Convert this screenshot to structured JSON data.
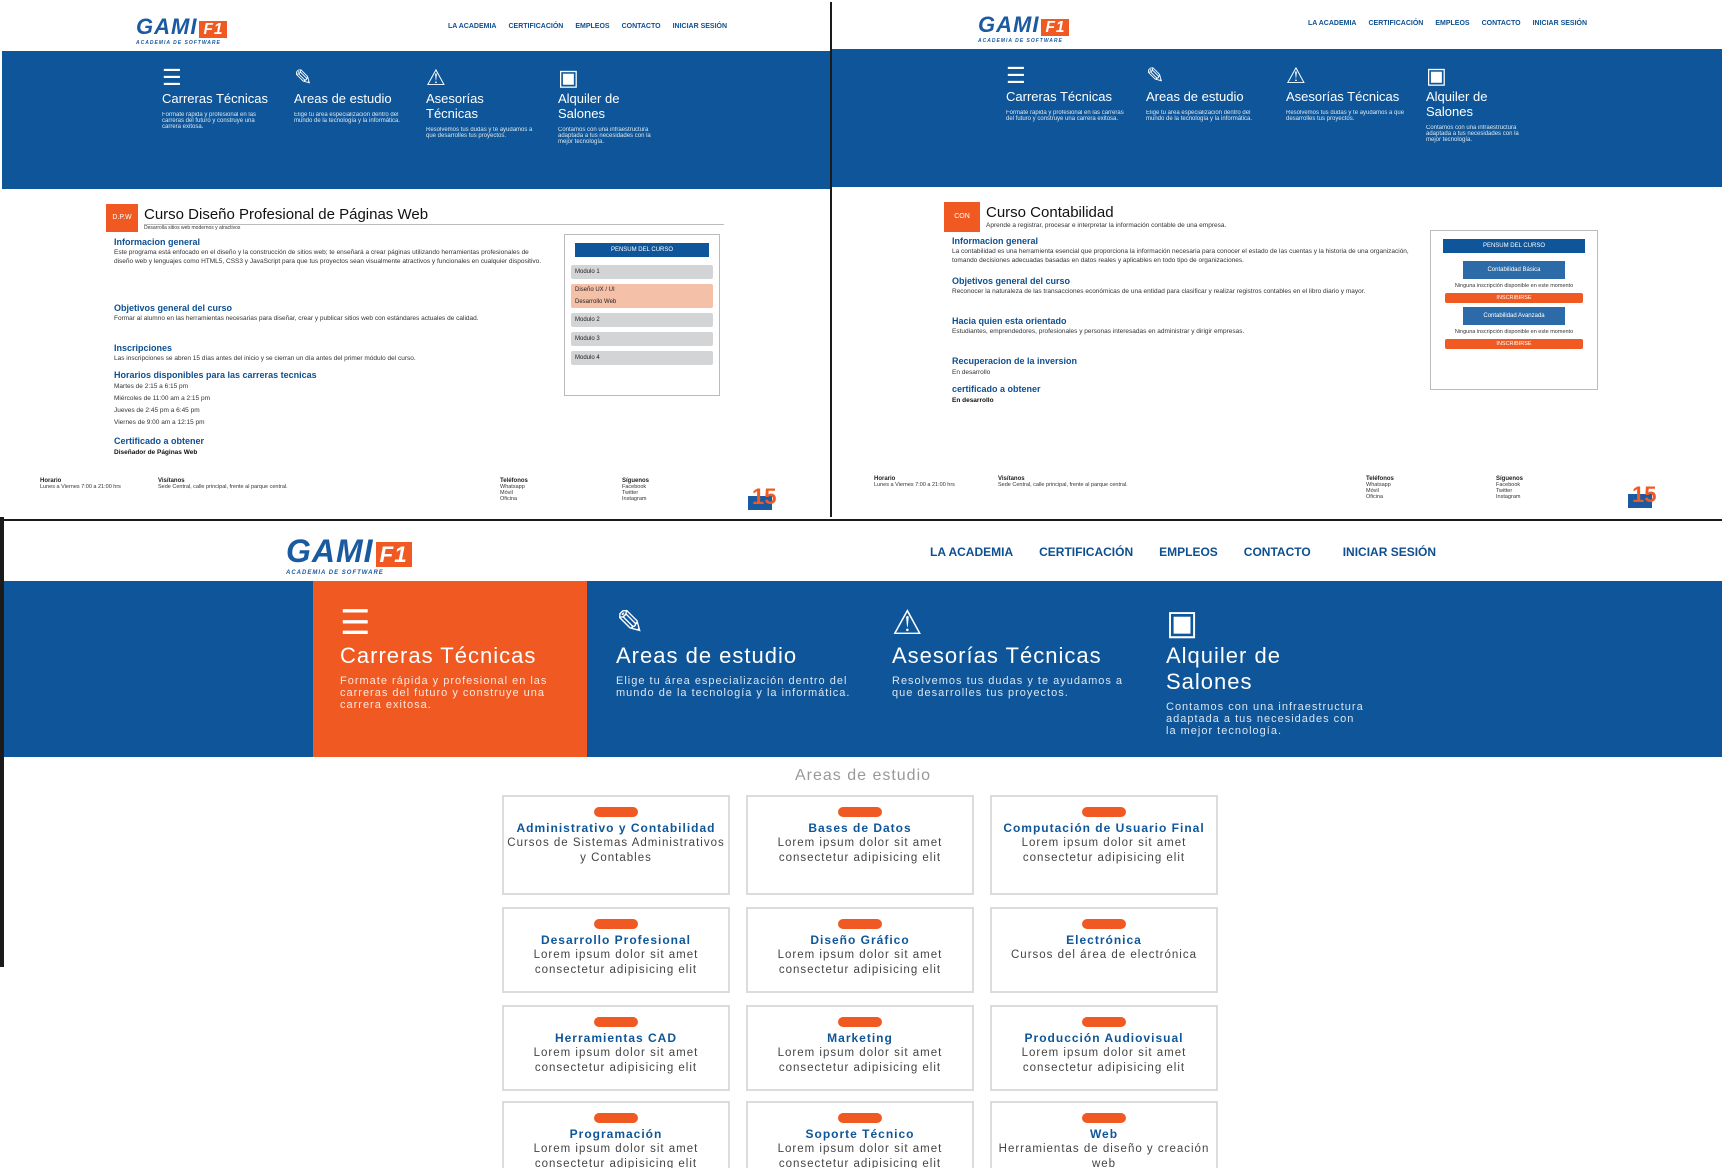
{
  "logo": {
    "text": "GAMI",
    "badge": "F1",
    "subtitle": "ACADEMIA DE SOFTWARE"
  },
  "nav": [
    "LA ACADEMIA",
    "CERTIFICACIÓN",
    "EMPLEOS",
    "CONTACTO",
    "INICIAR SESIÓN"
  ],
  "hero_tiles": [
    {
      "icon": "layers-icon",
      "title": "Carreras Técnicas",
      "desc": "Formate rápida y profesional en las carreras del futuro y construye una carrera exitosa."
    },
    {
      "icon": "edit-icon",
      "title": "Areas de estudio",
      "desc": "Elige tu área especialización dentro del mundo de la tecnología y la informática."
    },
    {
      "icon": "exclamation-icon",
      "title": "Asesorías Técnicas",
      "desc": "Resolvemos tus dudas y te ayudamos a que desarrolles tus proyectos."
    },
    {
      "icon": "board-icon",
      "title": "Alquiler de Salones",
      "desc": "Contamos con una infraestructura adaptada a tus necesidades con la mejor tecnología."
    }
  ],
  "course1": {
    "code": "D.P.W",
    "title": "Curso Diseño Profesional de Páginas Web",
    "subtitle": "Desarrolla sitios web modernos y atractivos",
    "sections": [
      {
        "heading": "Informacion general",
        "text": "Este programa está enfocado en el diseño y la construcción de sitios web; te enseñará a crear páginas utilizando herramientas profesionales de diseño web y lenguajes como HTML5, CSS3 y JavaScript para que tus proyectos sean visualmente atractivos y funcionales en cualquier dispositivo."
      },
      {
        "heading": "Objetivos general del curso",
        "text": "Formar al alumno en las herramientas necesarias para diseñar, crear y publicar sitios web con estándares actuales de calidad."
      },
      {
        "heading": "Inscripciones",
        "text": "Las inscripciones se abren 15 días antes del inicio y se cierran un día antes del primer módulo del curso."
      },
      {
        "heading": "Horarios disponibles para las carreras tecnicas",
        "lines": [
          "Martes de 2:15 a 6:15 pm",
          "Miércoles de 11:00 am a 2:15 pm",
          "Jueves de 2:45 pm a 6:45 pm",
          "Viernes de 9:00 am a 12:15 pm"
        ]
      },
      {
        "heading": "Certificado a obtener",
        "value": "Diseñador de Páginas Web"
      }
    ],
    "sidebar": {
      "header": "PENSUM DEL CURSO",
      "modules": [
        "Modulo 1",
        "Diseño UX / UI",
        "Desarrollo Web",
        "Modulo 2",
        "Modulo 3",
        "Modulo 4"
      ]
    }
  },
  "course2": {
    "code": "CON",
    "title": "Curso Contabilidad",
    "subtitle": "Aprende a registrar, procesar e interpretar la información contable de una empresa.",
    "sections": [
      {
        "heading": "Informacion general",
        "text": "La contabilidad es una herramienta esencial que proporciona la información necesaria para conocer el estado de las cuentas y la historia de una organización, tomando decisiones adecuadas basadas en datos reales y aplicables en todo tipo de organizaciones."
      },
      {
        "heading": "Objetivos general del curso",
        "text": "Reconocer la naturaleza de las transacciones económicas de una entidad para clasificar y realizar registros contables en el libro diario y mayor."
      },
      {
        "heading": "Hacia quien esta orientado",
        "text": "Estudiantes, emprendedores, profesionales y personas interesadas en administrar y dirigir empresas."
      },
      {
        "heading": "Recuperacion de la inversion",
        "value": "En desarrollo"
      },
      {
        "heading": "certificado a obtener",
        "value": "En desarrollo"
      }
    ],
    "sidebar": {
      "header": "PENSUM DEL CURSO",
      "blocks": [
        {
          "title": "Contabilidad Básica",
          "note": "Ninguna inscripción disponible en este momento",
          "button": "INSCRIBIRSE"
        },
        {
          "title": "Contabilidad Avanzada",
          "note": "Ninguna inscripción disponible en este momento",
          "button": "INSCRIBIRSE"
        }
      ]
    }
  },
  "footer": {
    "col1_title": "Horario",
    "col1_text": "Lunes a Viernes 7:00 a 21:00 hrs",
    "col2_title": "Visítanos",
    "col2_text": "Sede Central, calle principal, frente al parque central.",
    "col3_title": "Teléfonos",
    "col3_lines": [
      "Whatsapp",
      "Móvil",
      "Oficina"
    ],
    "col4_title": "Síguenos",
    "col4_lines": [
      "Facebook",
      "Twitter",
      "Instagram"
    ]
  },
  "landing": {
    "areas_title": "Areas de estudio",
    "cards": [
      {
        "title": "Administrativo y Contabilidad",
        "desc": "Cursos de Sistemas Administrativos y Contables"
      },
      {
        "title": "Bases de Datos",
        "desc": "Lorem ipsum dolor sit amet consectetur adipisicing elit"
      },
      {
        "title": "Computación de Usuario Final",
        "desc": "Lorem ipsum dolor sit amet consectetur adipisicing elit"
      },
      {
        "title": "Desarrollo Profesional",
        "desc": "Lorem ipsum dolor sit amet consectetur adipisicing elit"
      },
      {
        "title": "Diseño Gráfico",
        "desc": "Lorem ipsum dolor sit amet consectetur adipisicing elit"
      },
      {
        "title": "Electrónica",
        "desc": "Cursos del área de electrónica"
      },
      {
        "title": "Herramientas CAD",
        "desc": "Lorem ipsum dolor sit amet consectetur adipisicing elit"
      },
      {
        "title": "Marketing",
        "desc": "Lorem ipsum dolor sit amet consectetur adipisicing elit"
      },
      {
        "title": "Producción Audiovisual",
        "desc": "Lorem ipsum dolor sit amet consectetur adipisicing elit"
      },
      {
        "title": "Programación",
        "desc": "Lorem ipsum dolor sit amet consectetur adipisicing elit"
      },
      {
        "title": "Soporte Técnico",
        "desc": "Lorem ipsum dolor sit amet consectetur adipisicing elit"
      },
      {
        "title": "Web",
        "desc": "Herramientas de diseño y creación web"
      }
    ]
  },
  "colors": {
    "primary": "#0e5699",
    "accent": "#f05a22",
    "nav": "#0d4f91"
  }
}
